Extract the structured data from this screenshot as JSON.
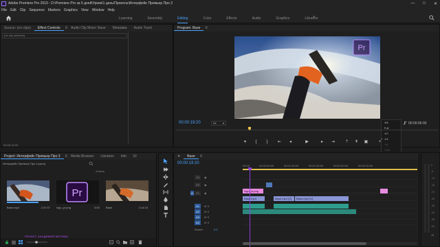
{
  "window": {
    "title": "Adobe Premiere Pro 2019 - D:\\Premiere Pro за 5 дней\\Уроки\\1 день\\Проекты\\Интерфейс Премьер Про 3",
    "controls": [
      "—",
      "□",
      "✕"
    ]
  },
  "menu": [
    "File",
    "Edit",
    "Clip",
    "Sequence",
    "Markers",
    "Graphics",
    "View",
    "Window",
    "Help"
  ],
  "workspace": {
    "tabs": [
      "Learning",
      "Assembly",
      "Editing",
      "Color",
      "Effects",
      "Audio",
      "Graphics",
      "Libraries"
    ],
    "active": "Editing",
    "more": "»"
  },
  "source_panel": {
    "tabs": [
      "Source: (no clips)",
      "Effect Controls",
      "Audio Clip Mixer: Base",
      "Metadata",
      "Audio Track"
    ],
    "active_tab": "Effect Controls",
    "menu_icon": "≡",
    "no_clip": "(no clip selected)",
    "timecode": "00:00:19:20"
  },
  "program": {
    "tab": "Program: Base",
    "menu_icon": "≡",
    "timecode": "00:00:19:20",
    "fit": "Fit",
    "duration": "00:00:09:00",
    "zoom_options": [
      "1/4",
      "Full",
      "1/2",
      "1/4",
      "1/8",
      "1/16"
    ],
    "zoom_selected_index": 3,
    "zoom_disabled": [
      4,
      5
    ],
    "video_overlay_logo": "Pr",
    "colors": {
      "timecode": "#4aa3ff"
    }
  },
  "project": {
    "tabs": [
      "Project: Интерфейс Премьер Про 3",
      "Media Browser",
      "Libraries",
      "Info",
      "Ef"
    ],
    "active_tab": "Project: Интерфейс Премьер Про 3",
    "path": "Интерфейс Премьер Про 3.prproj",
    "items_count": "4 items",
    "media": [
      {
        "name": "Base.mp4",
        "duration": "2:37:07"
      },
      {
        "name": "logo_pr.png",
        "duration": "5:00"
      },
      {
        "name": "Base",
        "duration": "2:14:15"
      }
    ],
    "watermark": "ПРОЕКТ АКАДЕМИЯ МОТИВА",
    "logo_text": "Pr"
  },
  "timeline": {
    "tab": "Base",
    "menu_icon": "≡",
    "timecode": "00:00:19:20",
    "ruler": [
      "00:00",
      "00:00:30:00",
      "00:01:00:00",
      "00:01:30:00",
      "00:02:00:00",
      "00:02:30:00"
    ],
    "tracks": [
      {
        "name": "V3",
        "type": "video"
      },
      {
        "name": "V2",
        "type": "video"
      },
      {
        "name": "V1",
        "type": "video"
      },
      {
        "name": "A1",
        "type": "audio",
        "flags": "M S"
      },
      {
        "name": "A2",
        "type": "audio",
        "flags": "M S"
      },
      {
        "name": "A3",
        "type": "audio",
        "flags": "M S"
      },
      {
        "name": "A4",
        "type": "audio",
        "flags": "M S"
      }
    ],
    "master": {
      "label": "Master",
      "value": "0.0"
    },
    "clips": {
      "logo": "logo_pr.png",
      "base1": "Base.mp4",
      "base2": "Base.mp4 [V]",
      "base3": "Base.mp4 [V]"
    },
    "v1_label": "V1"
  },
  "meters": {
    "ticks": [
      "0",
      "-6",
      "-12",
      "-18",
      "-24",
      "-30",
      "-36",
      "-42",
      "-48",
      "-54",
      "dB"
    ]
  }
}
